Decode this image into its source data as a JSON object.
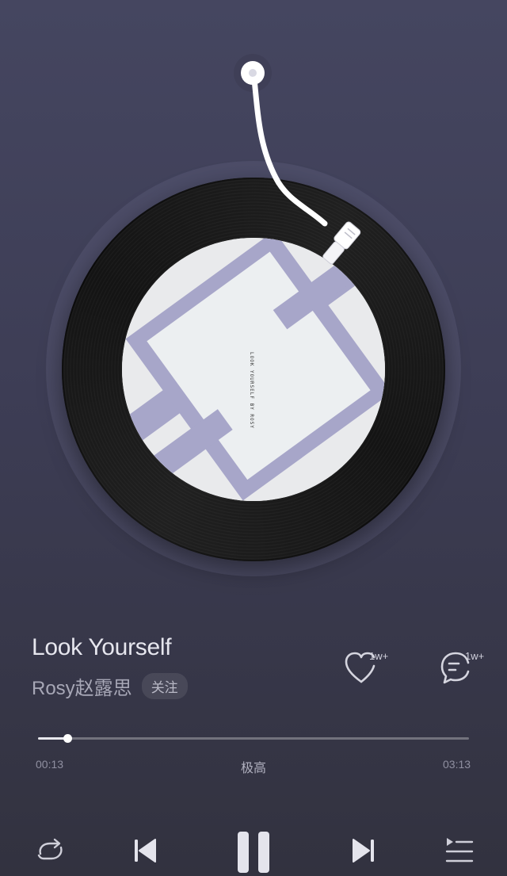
{
  "song": {
    "title": "Look Yourself",
    "artist": "Rosy赵露思",
    "follow_label": "关注"
  },
  "album_cover": {
    "text": "LOOK YOURSELF BY ROSY"
  },
  "actions": {
    "like_count": "1w+",
    "comment_count": "1w+"
  },
  "playback": {
    "current_time": "00:13",
    "total_time": "03:13",
    "quality_label": "极高",
    "progress": 0.068,
    "state": "playing"
  },
  "controls": {
    "repeat_icon": "repeat-icon",
    "previous_icon": "previous-icon",
    "pause_icon": "pause-icon",
    "next_icon": "next-icon",
    "playlist_icon": "playlist-icon"
  },
  "colors": {
    "background_top": "#454660",
    "background_bottom": "#32323f",
    "cover_accent": "#a7a6c9",
    "cover_base": "#e9eaec"
  }
}
